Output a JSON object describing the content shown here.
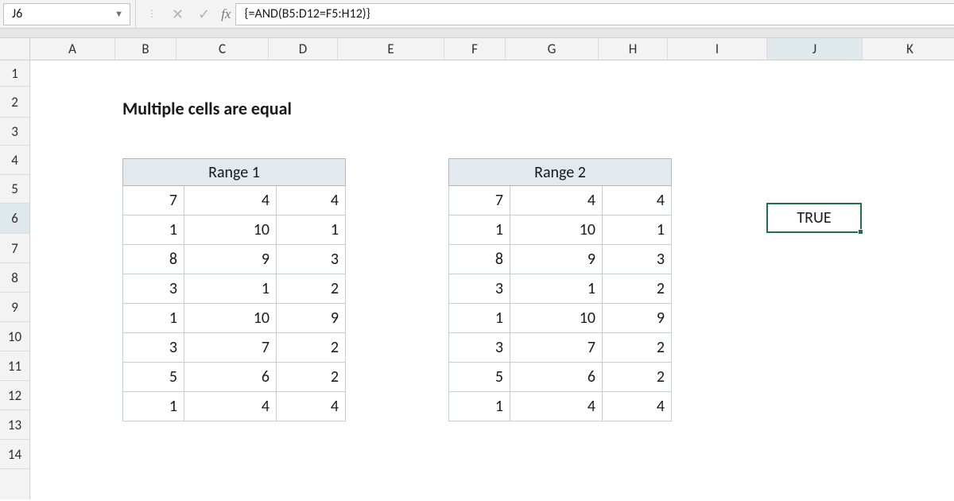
{
  "formula_bar": {
    "cell_ref": "J6",
    "formula": "{=AND(B5:D12=F5:H12)}"
  },
  "columns": [
    {
      "label": "A",
      "width": 107
    },
    {
      "label": "B",
      "width": 77
    },
    {
      "label": "C",
      "width": 116
    },
    {
      "label": "D",
      "width": 87
    },
    {
      "label": "E",
      "width": 134
    },
    {
      "label": "F",
      "width": 77
    },
    {
      "label": "G",
      "width": 117
    },
    {
      "label": "H",
      "width": 87
    },
    {
      "label": "I",
      "width": 125
    },
    {
      "label": "J",
      "width": 120
    },
    {
      "label": "K",
      "width": 120
    }
  ],
  "rows": [
    {
      "num": 1,
      "height": 33
    },
    {
      "num": 2,
      "height": 39
    },
    {
      "num": 3,
      "height": 35
    },
    {
      "num": 4,
      "height": 37
    },
    {
      "num": 5,
      "height": 36
    },
    {
      "num": 6,
      "height": 38
    },
    {
      "num": 7,
      "height": 37
    },
    {
      "num": 8,
      "height": 37
    },
    {
      "num": 9,
      "height": 37
    },
    {
      "num": 10,
      "height": 37
    },
    {
      "num": 11,
      "height": 37
    },
    {
      "num": 12,
      "height": 37
    },
    {
      "num": 13,
      "height": 37
    },
    {
      "num": 14,
      "height": 37
    }
  ],
  "active_row": 6,
  "active_col": "J",
  "title": "Multiple cells are equal",
  "range1": {
    "header": "Range 1",
    "data": [
      [
        7,
        4,
        4
      ],
      [
        1,
        10,
        1
      ],
      [
        8,
        9,
        3
      ],
      [
        3,
        1,
        2
      ],
      [
        1,
        10,
        9
      ],
      [
        3,
        7,
        2
      ],
      [
        5,
        6,
        2
      ],
      [
        1,
        4,
        4
      ]
    ]
  },
  "range2": {
    "header": "Range 2",
    "data": [
      [
        7,
        4,
        4
      ],
      [
        1,
        10,
        1
      ],
      [
        8,
        9,
        3
      ],
      [
        3,
        1,
        2
      ],
      [
        1,
        10,
        9
      ],
      [
        3,
        7,
        2
      ],
      [
        5,
        6,
        2
      ],
      [
        1,
        4,
        4
      ]
    ]
  },
  "result": {
    "value": "TRUE"
  },
  "chart_data": {
    "type": "table",
    "title": "Multiple cells are equal",
    "ranges": [
      {
        "name": "Range 1",
        "cells": "B5:D12",
        "values": [
          [
            7,
            4,
            4
          ],
          [
            1,
            10,
            1
          ],
          [
            8,
            9,
            3
          ],
          [
            3,
            1,
            2
          ],
          [
            1,
            10,
            9
          ],
          [
            3,
            7,
            2
          ],
          [
            5,
            6,
            2
          ],
          [
            1,
            4,
            4
          ]
        ]
      },
      {
        "name": "Range 2",
        "cells": "F5:H12",
        "values": [
          [
            7,
            4,
            4
          ],
          [
            1,
            10,
            1
          ],
          [
            8,
            9,
            3
          ],
          [
            3,
            1,
            2
          ],
          [
            1,
            10,
            9
          ],
          [
            3,
            7,
            2
          ],
          [
            5,
            6,
            2
          ],
          [
            1,
            4,
            4
          ]
        ]
      }
    ],
    "formula": "{=AND(B5:D12=F5:H12)}",
    "result_cell": "J6",
    "result_value": "TRUE"
  }
}
